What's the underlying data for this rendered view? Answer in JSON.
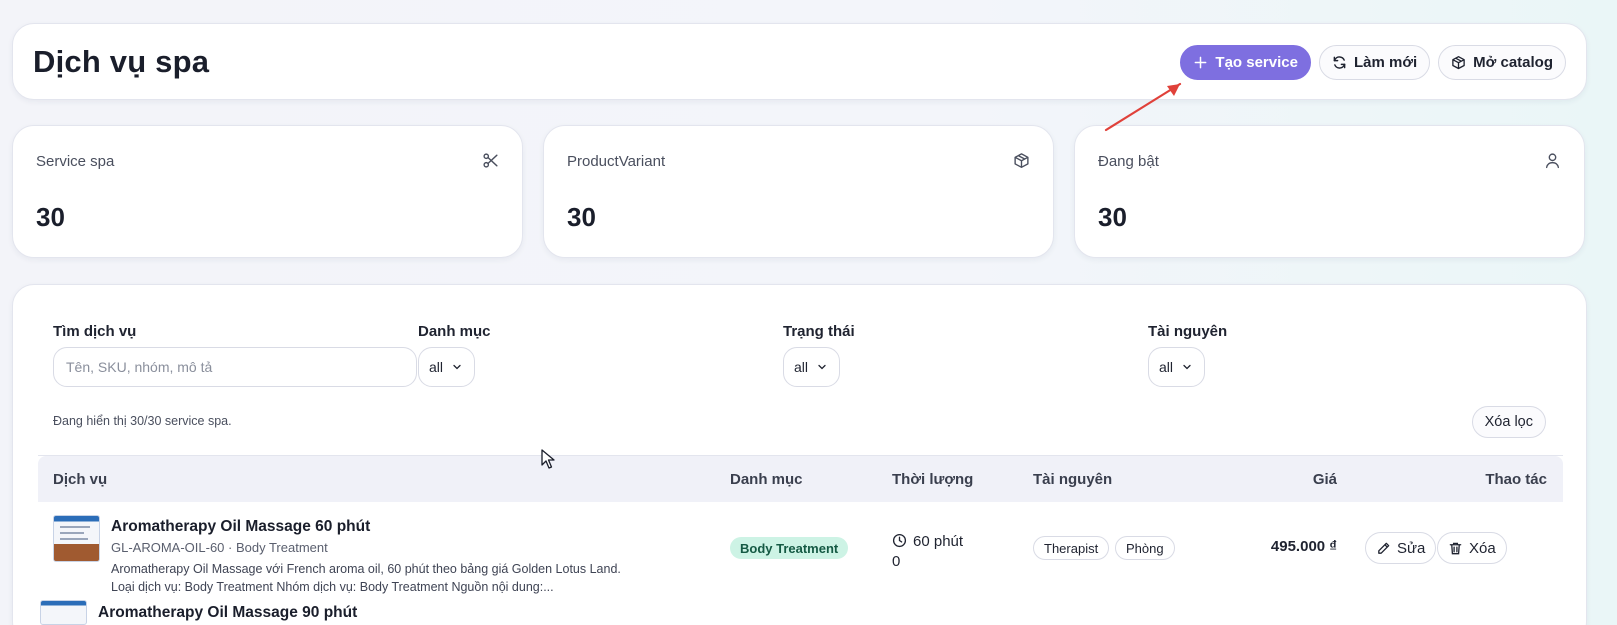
{
  "header": {
    "title": "Dịch vụ spa",
    "create_label": "Tạo service",
    "refresh_label": "Làm mới",
    "catalog_label": "Mở catalog"
  },
  "stats": [
    {
      "label": "Service spa",
      "value": "30",
      "icon": "scissors-icon"
    },
    {
      "label": "ProductVariant",
      "value": "30",
      "icon": "package-icon"
    },
    {
      "label": "Đang bật",
      "value": "30",
      "icon": "user-icon"
    }
  ],
  "filters": {
    "search_label": "Tìm dịch vụ",
    "search_placeholder": "Tên, SKU, nhóm, mô tả",
    "search_value": "",
    "category_label": "Danh mục",
    "category_value": "all",
    "status_label": "Trạng thái",
    "status_value": "all",
    "resource_label": "Tài nguyên",
    "resource_value": "all",
    "result_text": "Đang hiển thị 30/30 service spa.",
    "clear_label": "Xóa lọc"
  },
  "table": {
    "columns": [
      "Dịch vụ",
      "Danh mục",
      "Thời lượng",
      "Tài nguyên",
      "Giá",
      "Thao tác"
    ],
    "rows": [
      {
        "name": "Aromatherapy Oil Massage 60 phút",
        "sku": "GL-AROMA-OIL-60 · Body Treatment",
        "desc_line1": "Aromatherapy Oil Massage với French aroma oil, 60 phút theo bảng giá Golden Lotus Land.",
        "desc_line2": "Loại dịch vụ: Body Treatment Nhóm dịch vụ: Body Treatment Nguồn nội dung:...",
        "category": "Body Treatment",
        "duration_line1": "60 phút",
        "duration_line2": "0",
        "resources": [
          "Therapist",
          "Phòng"
        ],
        "price": "495.000 ₫",
        "edit_label": "Sửa",
        "delete_label": "Xóa"
      },
      {
        "name": "Aromatherapy Oil Massage 90 phút"
      }
    ]
  },
  "colors": {
    "primary": "#7e6fe0",
    "badge_bg": "#cdf3e5",
    "badge_text": "#155a44",
    "annotation_arrow": "#e0413a"
  }
}
